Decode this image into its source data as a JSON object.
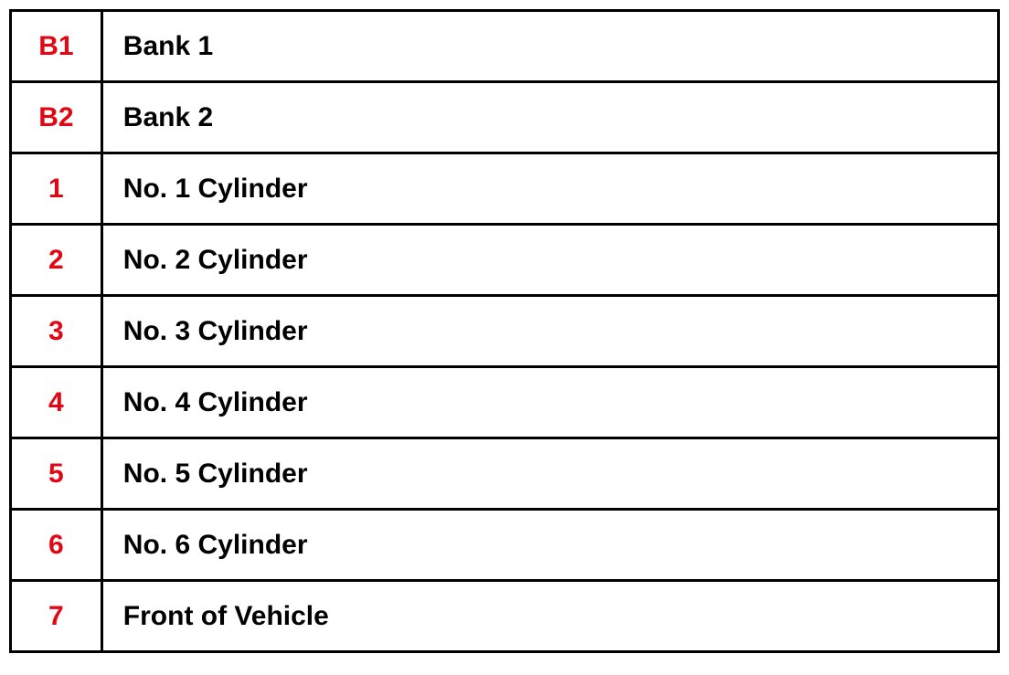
{
  "legend": {
    "rows": [
      {
        "key": "B1",
        "value": "Bank 1"
      },
      {
        "key": "B2",
        "value": "Bank 2"
      },
      {
        "key": "1",
        "value": "No. 1 Cylinder"
      },
      {
        "key": "2",
        "value": "No. 2 Cylinder"
      },
      {
        "key": "3",
        "value": "No. 3 Cylinder"
      },
      {
        "key": "4",
        "value": "No. 4 Cylinder"
      },
      {
        "key": "5",
        "value": "No. 5 Cylinder"
      },
      {
        "key": "6",
        "value": "No. 6 Cylinder"
      },
      {
        "key": "7",
        "value": "Front of Vehicle"
      }
    ]
  }
}
